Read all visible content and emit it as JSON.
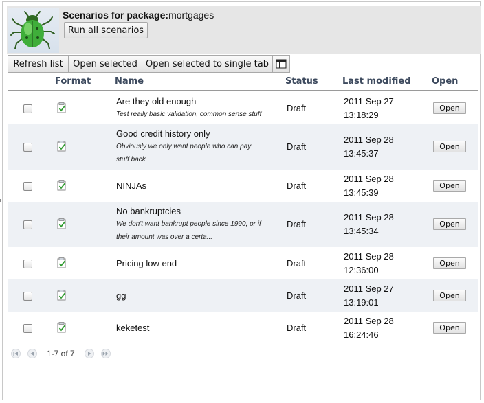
{
  "header": {
    "title_label": "Scenarios for package:",
    "package_name": "mortgages",
    "run_all_label": "Run all scenarios"
  },
  "toolbar": {
    "refresh_label": "Refresh list",
    "open_selected_label": "Open selected",
    "open_single_tab_label": "Open selected to single tab",
    "columns_icon": "column-picker-icon"
  },
  "columns": {
    "format": "Format",
    "name": "Name",
    "status": "Status",
    "last_modified": "Last modified",
    "open": "Open"
  },
  "rows": [
    {
      "name": "Are they old enough",
      "description_1": "Test really basic validation, common sense stuff",
      "description_2": "",
      "status": "Draft",
      "date": "2011 Sep 27",
      "time": "13:18:29",
      "open_label": "Open"
    },
    {
      "name": "Good credit history only",
      "description_1": "Obviously we only want people who can pay",
      "description_2": "stuff back",
      "status": "Draft",
      "date": "2011 Sep 28",
      "time": "13:45:37",
      "open_label": "Open"
    },
    {
      "name": "NINJAs",
      "description_1": "",
      "description_2": "",
      "status": "Draft",
      "date": "2011 Sep 28",
      "time": "13:45:39",
      "open_label": "Open"
    },
    {
      "name": "No bankruptcies",
      "description_1": "We don't want bankrupt people since 1990, or if",
      "description_2": "their amount was over a certa...",
      "status": "Draft",
      "date": "2011 Sep 28",
      "time": "13:45:34",
      "open_label": "Open"
    },
    {
      "name": "Pricing low end",
      "description_1": "",
      "description_2": "",
      "status": "Draft",
      "date": "2011 Sep 28",
      "time": "12:36:00",
      "open_label": "Open"
    },
    {
      "name": "gg",
      "description_1": "",
      "description_2": "",
      "status": "Draft",
      "date": "2011 Sep 27",
      "time": "13:19:01",
      "open_label": "Open"
    },
    {
      "name": "keketest",
      "description_1": "",
      "description_2": "",
      "status": "Draft",
      "date": "2011 Sep 28",
      "time": "16:24:46",
      "open_label": "Open"
    }
  ],
  "pager": {
    "range_text": "1-7 of 7",
    "icons": [
      "first-page-icon",
      "previous-page-icon",
      "next-page-icon",
      "last-page-icon"
    ]
  },
  "colors": {
    "header_bg": "#e6e6e6",
    "alt_row_bg": "#eef1f5",
    "column_header_text": "#3d4a5e",
    "bug_green": "#3fae3a"
  }
}
